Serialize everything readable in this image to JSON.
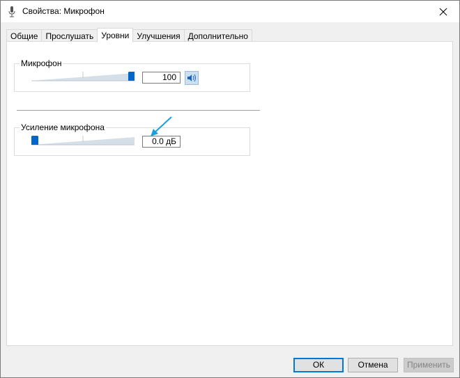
{
  "window": {
    "title": "Свойства: Микрофон",
    "close_icon": "close-icon",
    "app_icon": "microphone-icon"
  },
  "tabs": [
    {
      "label": "Общие",
      "active": false
    },
    {
      "label": "Прослушать",
      "active": false
    },
    {
      "label": "Уровни",
      "active": true
    },
    {
      "label": "Улучшения",
      "active": false
    },
    {
      "label": "Дополнительно",
      "active": false
    }
  ],
  "microphone": {
    "label": "Микрофон",
    "value": "100",
    "level_fraction": 1.0,
    "mute_icon": "speaker-icon"
  },
  "boost": {
    "label": "Усиление микрофона",
    "value": "0.0 дБ",
    "level_fraction": 0.0,
    "annotation_icon": "arrow-pointer-icon"
  },
  "buttons": {
    "ok": "ОК",
    "cancel": "Отмена",
    "apply": "Применить"
  },
  "colors": {
    "accent": "#0078d7",
    "annotation": "#1a9ee0"
  }
}
